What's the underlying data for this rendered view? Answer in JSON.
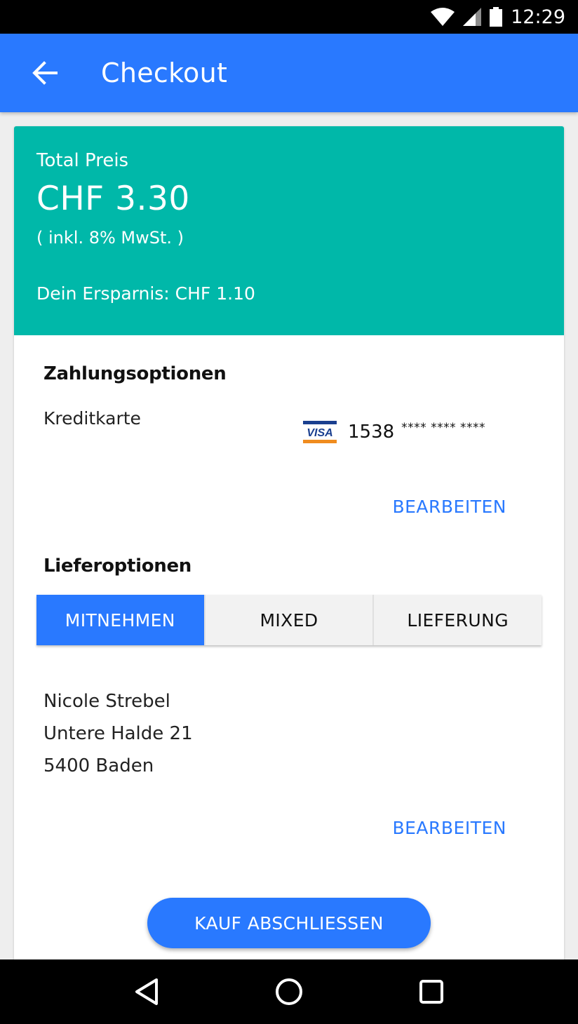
{
  "status_bar": {
    "time": "12:29",
    "icons": [
      "wifi-icon",
      "signal-icon",
      "battery-icon"
    ]
  },
  "app_bar": {
    "title": "Checkout",
    "back_icon": "arrow-back-icon"
  },
  "summary": {
    "total_label": "Total Preis",
    "total_price": "CHF 3.30",
    "vat_note": "( inkl. 8% MwSt. )",
    "savings": "Dein Ersparnis: CHF 1.10"
  },
  "payment": {
    "title": "Zahlungsoptionen",
    "method": "Kreditkarte",
    "card_brand": "VISA",
    "card_number": "1538",
    "card_mask": "**** **** ****",
    "edit_label": "BEARBEITEN"
  },
  "delivery": {
    "title": "Lieferoptionen",
    "options": [
      {
        "label": "MITNEHMEN",
        "selected": true
      },
      {
        "label": "MIXED",
        "selected": false
      },
      {
        "label": "LIEFERUNG",
        "selected": false
      }
    ],
    "address": {
      "name": "Nicole Strebel",
      "street": "Untere Halde 21",
      "city": "5400 Baden"
    },
    "edit_label": "BEARBEITEN"
  },
  "checkout_button": "KAUF ABSCHLIESSEN",
  "nav_bar": {
    "icons": [
      "back-triangle-icon",
      "home-circle-icon",
      "recents-square-icon"
    ]
  },
  "colors": {
    "primary": "#2979ff",
    "summary_bg": "#00b8a9",
    "segment_inactive": "#f2f2f2"
  }
}
